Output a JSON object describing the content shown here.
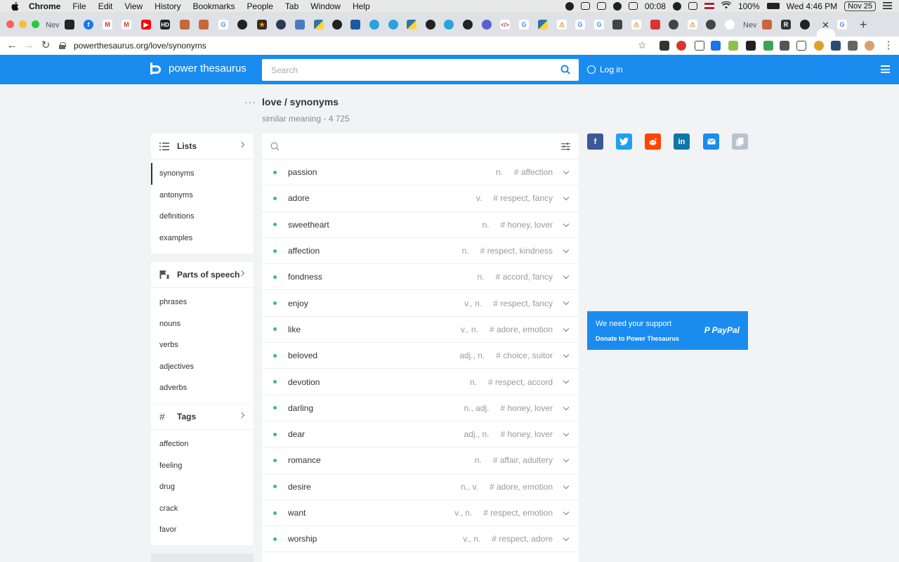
{
  "os_menubar": {
    "app": "Chrome",
    "menus": [
      "File",
      "Edit",
      "View",
      "History",
      "Bookmarks",
      "People",
      "Tab",
      "Window",
      "Help"
    ],
    "timer": "00:08",
    "battery": "100%",
    "clock": "Wed 4:46 PM",
    "date": "Nov 25"
  },
  "browser": {
    "first_tab_label": "Nev",
    "second_last_label": "Nev",
    "url": "powerthesaurus.org/love/synonyms"
  },
  "site": {
    "logo": "power thesaurus",
    "search_placeholder": "Search",
    "login": "Log in"
  },
  "page": {
    "title": "love / synonyms",
    "subtitle": "similar meaning - 4 725"
  },
  "sidebar": {
    "lists": {
      "title": "Lists",
      "items": [
        "synonyms",
        "antonyms",
        "definitions",
        "examples"
      ],
      "active": "synonyms"
    },
    "parts": {
      "title": "Parts of speech",
      "items": [
        "phrases",
        "nouns",
        "verbs",
        "adjectives",
        "adverbs"
      ]
    },
    "tags": {
      "title": "Tags",
      "items": [
        "affection",
        "feeling",
        "drug",
        "crack",
        "favor"
      ]
    }
  },
  "results": [
    {
      "word": "passion",
      "pos": "n.",
      "tags": "# affection"
    },
    {
      "word": "adore",
      "pos": "v.",
      "tags": "# respect, fancy"
    },
    {
      "word": "sweetheart",
      "pos": "n.",
      "tags": "# honey, lover"
    },
    {
      "word": "affection",
      "pos": "n.",
      "tags": "# respect, kindness"
    },
    {
      "word": "fondness",
      "pos": "n.",
      "tags": "# accord, fancy"
    },
    {
      "word": "enjoy",
      "pos": "v., n.",
      "tags": "# respect, fancy"
    },
    {
      "word": "like",
      "pos": "v., n.",
      "tags": "# adore, emotion"
    },
    {
      "word": "beloved",
      "pos": "adj., n.",
      "tags": "# choice, suitor"
    },
    {
      "word": "devotion",
      "pos": "n.",
      "tags": "# respect, accord"
    },
    {
      "word": "darling",
      "pos": "n., adj.",
      "tags": "# honey, lover"
    },
    {
      "word": "dear",
      "pos": "adj., n.",
      "tags": "# honey, lover"
    },
    {
      "word": "romance",
      "pos": "n.",
      "tags": "# affair, adultery"
    },
    {
      "word": "desire",
      "pos": "n., v.",
      "tags": "# adore, emotion"
    },
    {
      "word": "want",
      "pos": "v., n.",
      "tags": "# respect, emotion"
    },
    {
      "word": "worship",
      "pos": "v., n.",
      "tags": "# respect, adore"
    }
  ],
  "support": {
    "heading": "We need your support",
    "link": "Donate to Power Thesaurus",
    "brand": "PayPal"
  },
  "share_icons": [
    "facebook-icon",
    "twitter-icon",
    "reddit-icon",
    "linkedin-icon",
    "email-icon",
    "copy-icon"
  ],
  "colors": {
    "brand_blue": "#1a8cf0",
    "result_dot": "#3dbd6e"
  }
}
